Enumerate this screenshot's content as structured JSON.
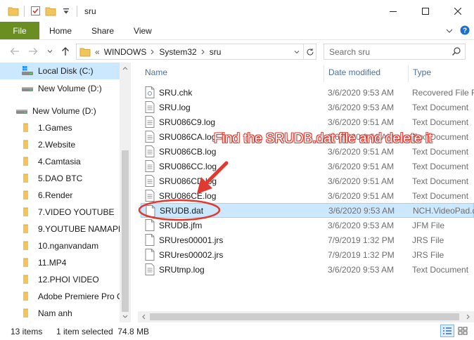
{
  "window": {
    "title": "sru"
  },
  "ribbon": {
    "tabs": [
      {
        "label": "File"
      },
      {
        "label": "Home"
      },
      {
        "label": "Share"
      },
      {
        "label": "View"
      }
    ]
  },
  "address": {
    "overflow": "«",
    "crumbs": [
      "WINDOWS",
      "System32",
      "sru"
    ]
  },
  "search": {
    "placeholder": "Search sru"
  },
  "nav": {
    "items": [
      {
        "label": "Local Disk (C:)",
        "icon": "os-drive-icon",
        "selected": true
      },
      {
        "label": "New Volume (D:)",
        "icon": "drive-icon"
      },
      {
        "label": "New Volume (D:)",
        "icon": "drive-icon"
      },
      {
        "label": "1.Games",
        "icon": "folder-icon"
      },
      {
        "label": "2.Website",
        "icon": "folder-icon"
      },
      {
        "label": "4.Camtasia",
        "icon": "folder-icon"
      },
      {
        "label": "5.DAO BTC",
        "icon": "folder-icon"
      },
      {
        "label": "6.Render",
        "icon": "folder-icon"
      },
      {
        "label": "7.VIDEO YOUTUBE",
        "icon": "folder-icon"
      },
      {
        "label": "9.YOUTUBE NAMAPK",
        "icon": "folder-icon"
      },
      {
        "label": "10.nganvandam",
        "icon": "folder-icon"
      },
      {
        "label": "11.MP4",
        "icon": "folder-icon"
      },
      {
        "label": "12.PHOI VIDEO",
        "icon": "folder-icon"
      },
      {
        "label": "Adobe Premiere Pro C",
        "icon": "folder-icon"
      },
      {
        "label": "Nam anh",
        "icon": "folder-icon"
      }
    ]
  },
  "columns": {
    "name": "Name",
    "date": "Date modified",
    "type": "Type"
  },
  "files": [
    {
      "name": "SRU.chk",
      "date": "3/6/2020 9:53 AM",
      "type": "Recovered File F",
      "icon": "file-chk-icon"
    },
    {
      "name": "SRU.log",
      "date": "3/6/2020 9:53 AM",
      "type": "Text Document",
      "icon": "text-file-icon"
    },
    {
      "name": "SRU086C9.log",
      "date": "3/6/2020 9:51 AM",
      "type": "Text Document",
      "icon": "text-file-icon"
    },
    {
      "name": "SRU086CA.log",
      "date": "3/6/2020 9:51 AM",
      "type": "Text Document",
      "icon": "text-file-icon"
    },
    {
      "name": "SRU086CB.log",
      "date": "3/6/2020 9:51 AM",
      "type": "Text Document",
      "icon": "text-file-icon"
    },
    {
      "name": "SRU086CC.log",
      "date": "3/6/2020 9:51 AM",
      "type": "Text Document",
      "icon": "text-file-icon"
    },
    {
      "name": "SRU086CD.log",
      "date": "3/6/2020 9:51 AM",
      "type": "Text Document",
      "icon": "text-file-icon"
    },
    {
      "name": "SRU086CE.log",
      "date": "3/6/2020 9:51 AM",
      "type": "Text Document",
      "icon": "text-file-icon"
    },
    {
      "name": "SRUDB.dat",
      "date": "3/6/2020 9:53 AM",
      "type": "NCH.VideoPad.d",
      "icon": "blank-file-icon",
      "selected": true
    },
    {
      "name": "SRUDB.jfm",
      "date": "3/6/2020 9:53 AM",
      "type": "JFM File",
      "icon": "blank-file-icon"
    },
    {
      "name": "SRUres00001.jrs",
      "date": "7/9/2019 1:32 PM",
      "type": "JRS File",
      "icon": "blank-file-icon"
    },
    {
      "name": "SRUres00002.jrs",
      "date": "7/9/2019 1:32 PM",
      "type": "JRS File",
      "icon": "blank-file-icon"
    },
    {
      "name": "SRUtmp.log",
      "date": "3/6/2020 9:53 AM",
      "type": "Text Document",
      "icon": "text-file-icon"
    }
  ],
  "status": {
    "count": "13 items",
    "selection": "1 item selected  74.8 MB"
  },
  "annotation": {
    "text": "Find the SRUDB.dat file and delete it",
    "color": "#e0392f"
  },
  "colors": {
    "file_tab": "#6b8e23",
    "selection": "#cce8ff",
    "header_text": "#4c6fa0",
    "folder": "#f2c55c"
  }
}
